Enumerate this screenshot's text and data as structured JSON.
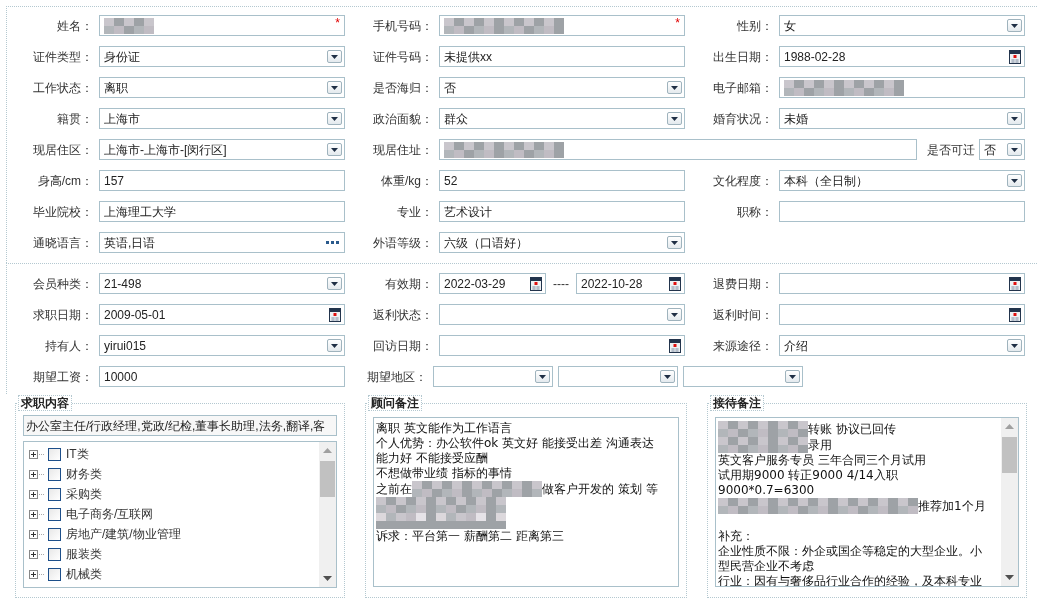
{
  "sections": [
    {
      "rows": [
        [
          {
            "label": "姓名：",
            "fields": [
              {
                "kind": "text",
                "redacted": true,
                "required_mark": "*"
              }
            ]
          },
          {
            "label": "手机号码：",
            "fields": [
              {
                "kind": "text",
                "redacted": true,
                "required_mark": "*"
              }
            ]
          },
          {
            "label": "性别：",
            "fields": [
              {
                "kind": "select",
                "value": "女"
              }
            ]
          }
        ],
        [
          {
            "label": "证件类型：",
            "fields": [
              {
                "kind": "select",
                "value": "身份证"
              }
            ]
          },
          {
            "label": "证件号码：",
            "fields": [
              {
                "kind": "text",
                "value": "未提供xx"
              }
            ]
          },
          {
            "label": "出生日期：",
            "fields": [
              {
                "kind": "date",
                "value": "1988-02-28"
              }
            ]
          }
        ],
        [
          {
            "label": "工作状态：",
            "fields": [
              {
                "kind": "select",
                "value": "离职"
              }
            ]
          },
          {
            "label": "是否海归：",
            "fields": [
              {
                "kind": "select",
                "value": "否"
              }
            ]
          },
          {
            "label": "电子邮箱：",
            "fields": [
              {
                "kind": "text",
                "redacted": true
              }
            ]
          }
        ],
        [
          {
            "label": "籍贯：",
            "fields": [
              {
                "kind": "select",
                "value": "上海市"
              }
            ]
          },
          {
            "label": "政治面貌：",
            "fields": [
              {
                "kind": "select",
                "value": "群众"
              }
            ]
          },
          {
            "label": "婚育状况：",
            "fields": [
              {
                "kind": "select",
                "value": "未婚"
              }
            ]
          }
        ],
        [
          {
            "label": "现居住区：",
            "fields": [
              {
                "kind": "select",
                "value": "上海市-上海市-[闵行区]"
              }
            ]
          },
          {
            "label": "现居住址：",
            "fields": [
              {
                "kind": "text",
                "redacted": true
              }
            ],
            "trailing": {
              "label": "是否可迁",
              "fields": [
                {
                  "kind": "select",
                  "value": "否"
                }
              ]
            }
          }
        ],
        [
          {
            "label": "身高/cm：",
            "fields": [
              {
                "kind": "text",
                "value": "157"
              }
            ]
          },
          {
            "label": "体重/kg：",
            "fields": [
              {
                "kind": "text",
                "value": "52"
              }
            ]
          },
          {
            "label": "文化程度：",
            "fields": [
              {
                "kind": "select",
                "value": "本科（全日制）"
              }
            ]
          }
        ],
        [
          {
            "label": "毕业院校：",
            "fields": [
              {
                "kind": "text",
                "value": "上海理工大学"
              }
            ]
          },
          {
            "label": "专业：",
            "fields": [
              {
                "kind": "text",
                "value": "艺术设计"
              }
            ]
          },
          {
            "label": "职称：",
            "fields": [
              {
                "kind": "text"
              }
            ]
          }
        ],
        [
          {
            "label": "通晓语言：",
            "fields": [
              {
                "kind": "picker",
                "value": "英语,日语"
              }
            ]
          },
          {
            "label": "外语等级：",
            "fields": [
              {
                "kind": "select",
                "value": "六级（口语好）"
              }
            ]
          }
        ]
      ]
    },
    {
      "rows": [
        [
          {
            "label": "会员种类：",
            "fields": [
              {
                "kind": "select",
                "value": "21-498"
              }
            ]
          },
          {
            "label": "有效期：",
            "separator": "----",
            "fields": [
              {
                "kind": "date",
                "value": "2022-03-29"
              },
              {
                "kind": "date",
                "value": "2022-10-28"
              }
            ]
          },
          {
            "label": "退费日期：",
            "fields": [
              {
                "kind": "date"
              }
            ]
          }
        ],
        [
          {
            "label": "求职日期：",
            "fields": [
              {
                "kind": "date",
                "value": "2009-05-01"
              }
            ]
          },
          {
            "label": "返利状态：",
            "fields": [
              {
                "kind": "select"
              }
            ]
          },
          {
            "label": "返利时间：",
            "fields": [
              {
                "kind": "date"
              }
            ]
          }
        ],
        [
          {
            "label": "持有人：",
            "fields": [
              {
                "kind": "select",
                "value": "yirui015"
              }
            ]
          },
          {
            "label": "回访日期：",
            "fields": [
              {
                "kind": "date"
              }
            ]
          },
          {
            "label": "来源途径：",
            "fields": [
              {
                "kind": "select",
                "value": "介绍"
              }
            ]
          }
        ],
        [
          {
            "label": "期望工资：",
            "fields": [
              {
                "kind": "text",
                "value": "10000"
              }
            ]
          },
          {
            "label": "期望地区：",
            "fields": [
              {
                "kind": "select"
              },
              {
                "kind": "select"
              },
              {
                "kind": "select"
              }
            ]
          }
        ]
      ]
    }
  ],
  "job_panel": {
    "legend": "求职内容",
    "selection": "办公室主任/行政经理,党政/纪检,董事长助理,法务,翻译,客",
    "tree": [
      {
        "label": "IT类",
        "checked": false,
        "expanded": false
      },
      {
        "label": "财务类",
        "checked": false,
        "expanded": false
      },
      {
        "label": "采购类",
        "checked": false,
        "expanded": false
      },
      {
        "label": "电子商务/互联网",
        "checked": false,
        "expanded": false
      },
      {
        "label": "房地产/建筑/物业管理",
        "checked": false,
        "expanded": false
      },
      {
        "label": "服装类",
        "checked": false,
        "expanded": false
      },
      {
        "label": "机械类",
        "checked": false,
        "expanded": false
      }
    ]
  },
  "note_panels": [
    {
      "legend": "顾问备注",
      "scrollbar": false,
      "lines": [
        [
          {
            "kind": "text",
            "text": "离职 英文能作为工作语言"
          }
        ],
        [
          {
            "kind": "text",
            "text": "个人优势：办公软件ok  英文好 能接受出差  沟通表达"
          }
        ],
        [
          {
            "kind": "text",
            "text": "能力好  不能接受应酬"
          }
        ],
        [
          {
            "kind": "text",
            "text": "不想做带业绩 指标的事情"
          }
        ],
        [
          {
            "kind": "text",
            "text": "之前在"
          },
          {
            "kind": "redacted"
          },
          {
            "kind": "text",
            "text": "做客户开发的 策划 等"
          }
        ],
        [
          {
            "kind": "redacted_tall"
          }
        ],
        [
          {
            "kind": "text",
            "text": "诉求：平台第一 薪酬第二 距离第三"
          }
        ]
      ]
    },
    {
      "legend": "接待备注",
      "scrollbar": true,
      "lines": [
        [
          {
            "kind": "redacted"
          },
          {
            "kind": "text",
            "text": "转账 协议已回传"
          }
        ],
        [
          {
            "kind": "redacted"
          },
          {
            "kind": "text",
            "text": "录用"
          }
        ],
        [
          {
            "kind": "text",
            "text": "英文客户服务专员  三年合同三个月试用"
          }
        ],
        [
          {
            "kind": "text",
            "text": "试用期9000 转正9000 4/14入职"
          }
        ],
        [
          {
            "kind": "text",
            "text": "9000*0.7=6300"
          }
        ],
        [
          {
            "kind": "redacted_wide"
          },
          {
            "kind": "text",
            "text": "推荐加1个月"
          }
        ],
        [
          {
            "kind": "gap"
          }
        ],
        [
          {
            "kind": "text",
            "text": "补充："
          }
        ],
        [
          {
            "kind": "text",
            "text": "企业性质不限：外企或国企等稳定的大型企业。小"
          }
        ],
        [
          {
            "kind": "text",
            "text": "型民营企业不考虑"
          }
        ],
        [
          {
            "kind": "text",
            "text": "行业：因有与奢侈品行业合作的经验，及本科专业"
          }
        ]
      ]
    }
  ]
}
